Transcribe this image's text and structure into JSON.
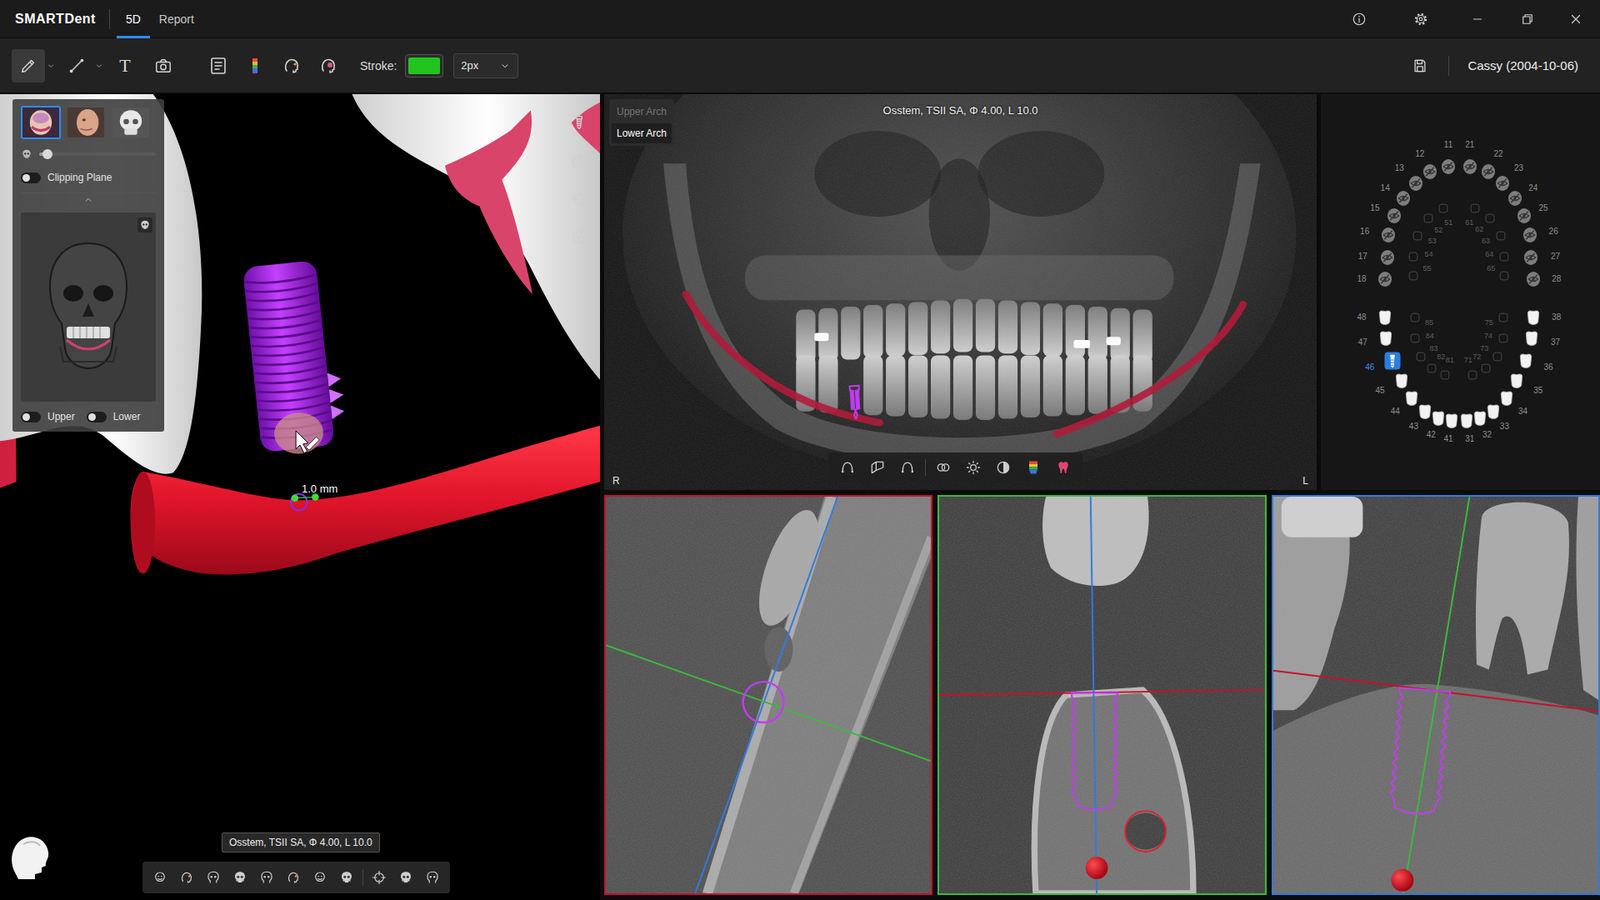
{
  "app": {
    "logo": "SMARTDent",
    "tabs": [
      {
        "label": "5D",
        "selected": true
      },
      {
        "label": "Report",
        "selected": false
      }
    ]
  },
  "toolbar": {
    "tools": [
      {
        "selected": true,
        "has_menu": true
      },
      {
        "selected": false,
        "has_menu": true
      },
      {
        "label": "T",
        "selected": false,
        "has_menu": false
      },
      {
        "selected": false,
        "has_menu": false
      }
    ],
    "stroke": {
      "label": "Stroke:",
      "color": "#22c51e",
      "width": "2px"
    },
    "patient": "Cassy (2004-10-06)"
  },
  "view3d": {
    "panel": {
      "views": [
        {
          "selected": true
        },
        {
          "selected": false
        },
        {
          "selected": false
        }
      ],
      "opacity": {
        "level": 0.07
      },
      "clipping_plane": {
        "label": "Clipping Plane",
        "on": false
      },
      "upper": {
        "label": "Upper",
        "on": false
      },
      "lower": {
        "label": "Lower",
        "on": false
      }
    },
    "measurement": "1.0 mm",
    "implant_tooltip": "Osstem, TSII SA, Φ 4.00, L 10.0"
  },
  "panorama": {
    "arches": [
      {
        "label": "Upper Arch",
        "selected": false
      },
      {
        "label": "Lower Arch",
        "selected": true
      }
    ],
    "implant_label": "Osstem, TSII SA, Φ 4.00, L 10.0",
    "side_left": "R",
    "side_right": "L"
  },
  "tooth_chart": {
    "teeth": [
      {
        "number": "18",
        "kind": "hidden",
        "selected": false
      },
      {
        "number": "17",
        "kind": "hidden",
        "selected": false
      },
      {
        "number": "16",
        "kind": "hidden",
        "selected": false
      },
      {
        "number": "15",
        "kind": "hidden",
        "selected": false
      },
      {
        "number": "14",
        "kind": "hidden",
        "selected": false
      },
      {
        "number": "13",
        "kind": "hidden",
        "selected": false
      },
      {
        "number": "12",
        "kind": "hidden",
        "selected": false
      },
      {
        "number": "11",
        "kind": "hidden",
        "selected": false
      },
      {
        "number": "21",
        "kind": "hidden",
        "selected": false
      },
      {
        "number": "22",
        "kind": "hidden",
        "selected": false
      },
      {
        "number": "23",
        "kind": "hidden",
        "selected": false
      },
      {
        "number": "24",
        "kind": "hidden",
        "selected": false
      },
      {
        "number": "25",
        "kind": "hidden",
        "selected": false
      },
      {
        "number": "26",
        "kind": "hidden",
        "selected": false
      },
      {
        "number": "27",
        "kind": "hidden",
        "selected": false
      },
      {
        "number": "28",
        "kind": "hidden",
        "selected": false
      },
      {
        "number": "55",
        "kind": "primary",
        "selected": false
      },
      {
        "number": "54",
        "kind": "primary",
        "selected": false
      },
      {
        "number": "53",
        "kind": "primary",
        "selected": false
      },
      {
        "number": "52",
        "kind": "primary",
        "selected": false
      },
      {
        "number": "51",
        "kind": "primary",
        "selected": false
      },
      {
        "number": "61",
        "kind": "primary",
        "selected": false
      },
      {
        "number": "62",
        "kind": "primary",
        "selected": false
      },
      {
        "number": "63",
        "kind": "primary",
        "selected": false
      },
      {
        "number": "64",
        "kind": "primary",
        "selected": false
      },
      {
        "number": "65",
        "kind": "primary",
        "selected": false
      },
      {
        "number": "48",
        "kind": "present",
        "selected": false
      },
      {
        "number": "47",
        "kind": "present",
        "selected": false
      },
      {
        "number": "46",
        "kind": "implant",
        "selected": true
      },
      {
        "number": "45",
        "kind": "present",
        "selected": false
      },
      {
        "number": "44",
        "kind": "present",
        "selected": false
      },
      {
        "number": "43",
        "kind": "present",
        "selected": false
      },
      {
        "number": "42",
        "kind": "present",
        "selected": false
      },
      {
        "number": "41",
        "kind": "present",
        "selected": false
      },
      {
        "number": "31",
        "kind": "present",
        "selected": false
      },
      {
        "number": "32",
        "kind": "present",
        "selected": false
      },
      {
        "number": "33",
        "kind": "present",
        "selected": false
      },
      {
        "number": "34",
        "kind": "present",
        "selected": false
      },
      {
        "number": "35",
        "kind": "present",
        "selected": false
      },
      {
        "number": "36",
        "kind": "present",
        "selected": false
      },
      {
        "number": "37",
        "kind": "present",
        "selected": false
      },
      {
        "number": "38",
        "kind": "present",
        "selected": false
      },
      {
        "number": "85",
        "kind": "primary",
        "selected": false
      },
      {
        "number": "84",
        "kind": "primary",
        "selected": false
      },
      {
        "number": "83",
        "kind": "primary",
        "selected": false
      },
      {
        "number": "82",
        "kind": "primary",
        "selected": false
      },
      {
        "number": "81",
        "kind": "primary",
        "selected": false
      },
      {
        "number": "71",
        "kind": "primary",
        "selected": false
      },
      {
        "number": "72",
        "kind": "primary",
        "selected": false
      },
      {
        "number": "73",
        "kind": "primary",
        "selected": false
      },
      {
        "number": "74",
        "kind": "primary",
        "selected": false
      },
      {
        "number": "75",
        "kind": "primary",
        "selected": false
      }
    ]
  },
  "slices": [
    {
      "color": "#c8102e"
    },
    {
      "color": "#3cb93c"
    },
    {
      "color": "#2f7be0"
    }
  ]
}
